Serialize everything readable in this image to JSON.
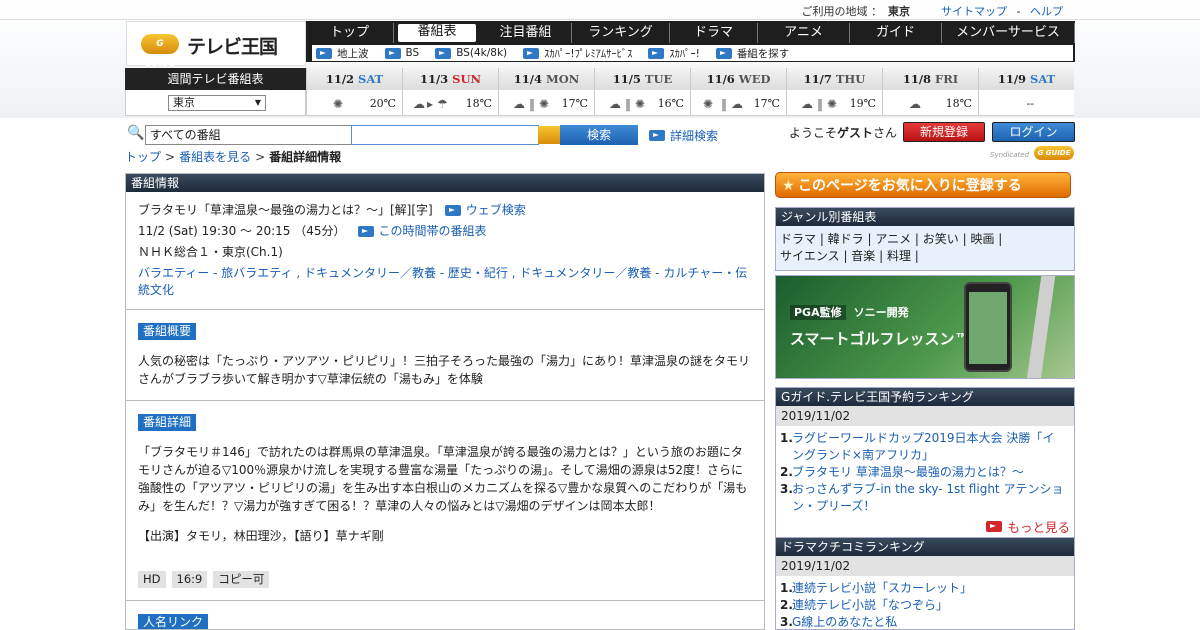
{
  "topbar": {
    "area_label": "ご利用の地域 ：",
    "area_value": "東京",
    "sitemap": "サイトマップ",
    "sep": "-",
    "help": "ヘルプ"
  },
  "logo": {
    "badge": "G GUIDE",
    "text": "テレビ王国"
  },
  "nav": {
    "tabs": [
      "トップ",
      "番組表",
      "注目番組",
      "ランキング",
      "ドラマ",
      "アニメ",
      "ガイド",
      "メンバーサービス"
    ],
    "active": "番組表",
    "sub": [
      "地上波",
      "BS",
      "BS(4k/8k)",
      "ｽｶﾊﾟｰ!ﾌﾟﾚﾐｱﾑｻｰﾋﾞｽ",
      "ｽｶﾊﾟｰ!",
      "番組を探す"
    ]
  },
  "week": {
    "label": "週間テレビ番組表",
    "region": "東京",
    "days": [
      {
        "date": "11/2",
        "wd": "SAT",
        "kind": "sat",
        "weather": "sun",
        "temp": "20℃"
      },
      {
        "date": "11/3",
        "wd": "SUN",
        "kind": "sun",
        "weather": "cloud-rain",
        "temp": "18℃"
      },
      {
        "date": "11/4",
        "wd": "MON",
        "kind": "wk",
        "weather": "cloud-sun",
        "temp": "17℃"
      },
      {
        "date": "11/5",
        "wd": "TUE",
        "kind": "wk",
        "weather": "cloud-sun",
        "temp": "16℃"
      },
      {
        "date": "11/6",
        "wd": "WED",
        "kind": "wk",
        "weather": "sun-cloud",
        "temp": "17℃"
      },
      {
        "date": "11/7",
        "wd": "THU",
        "kind": "wk",
        "weather": "cloud-sun",
        "temp": "19℃"
      },
      {
        "date": "11/8",
        "wd": "FRI",
        "kind": "wk",
        "weather": "cloud",
        "temp": "18℃"
      },
      {
        "date": "11/9",
        "wd": "SAT",
        "kind": "sat",
        "weather": "none",
        "temp": "--"
      }
    ]
  },
  "search": {
    "category": "すべての番組",
    "button": "検索",
    "advanced": "詳細検索",
    "welcome_pre": "ようこそ",
    "welcome_name": "ゲスト",
    "welcome_post": "さん",
    "register": "新規登録",
    "login": "ログイン"
  },
  "breadcrumb": {
    "top": "トップ",
    "sep": ">",
    "schedule": "番組表を見る",
    "current": "番組詳細情報"
  },
  "syndicated": {
    "label": "Syndicated",
    "badge": "G GUIDE"
  },
  "program": {
    "header": "番組情報",
    "title": "ブラタモリ「草津温泉～最強の湯力とは？～」[解][字]",
    "web_search": "ウェブ検索",
    "time": "11/2 (Sat) 19:30 ～ 20:15 （45分）",
    "timeslot_link": "この時間帯の番組表",
    "channel": "ＮＨＫ総合１・東京(Ch.1)",
    "genres": "バラエティー - 旅バラエティ , ドキュメンタリー／教養 - 歴史・紀行 , ドキュメンタリー／教養 - カルチャー・伝統文化",
    "summary_label": "番組概要",
    "summary": "人気の秘密は「たっぷり・アツアツ・ピリピリ」！三拍子そろった最強の「湯力」にあり！草津温泉の謎をタモリさんがブラブラ歩いて解き明かす▽草津伝統の「湯もみ」を体験",
    "detail_label": "番組詳細",
    "detail": "「ブラタモリ＃146」で訪れたのは群馬県の草津温泉。「草津温泉が誇る最強の湯力とは？」という旅のお題にタモリさんが迫る▽100％源泉かけ流しを実現する豊富な湯量「たっぷりの湯」。そして湯畑の源泉は52度！さらに強酸性の「アツアツ・ピリピリの湯」を生み出す本白根山のメカニズムを探る▽豊かな泉質へのこだわりが「湯もみ」を生んだ！？▽湯力が強すぎて困る！？草津の人々の悩みとは▽湯畑のデザインは岡本太郎！",
    "cast": "【出演】タモリ，林田理沙，【語り】草ナギ剛",
    "tags": [
      "HD",
      "16:9",
      "コピー可"
    ],
    "people_label": "人名リンク"
  },
  "side": {
    "fav": "このページをお気に入りに登録する",
    "genre_header": "ジャンル別番組表",
    "genres_line1": "ドラマ | 韓ドラ | アニメ | お笑い | 映画 |",
    "genres_line2": "サイエンス | 音楽 | 料理 |",
    "ad_badge": "PGA監修",
    "ad_brand": "ソニー開発",
    "ad_title": "スマートゴルフレッスン™",
    "rank_header": "Gガイド.テレビ王国予約ランキング",
    "rank_date": "2019/11/02",
    "rank": [
      "ラグビーワールドカップ2019日本大会 決勝「イングランド×南アフリカ」",
      "ブラタモリ 草津温泉〜最強の湯力とは？〜",
      "おっさんずラブ-in the sky- 1st flight アテンション・プリーズ！"
    ],
    "more": "もっと見る",
    "drama_header": "ドラマクチコミランキング",
    "drama_date": "2019/11/02",
    "drama": [
      "連続テレビ小説「スカーレット」",
      "連続テレビ小説「なつぞら」",
      "G線上のあなたと私"
    ]
  }
}
